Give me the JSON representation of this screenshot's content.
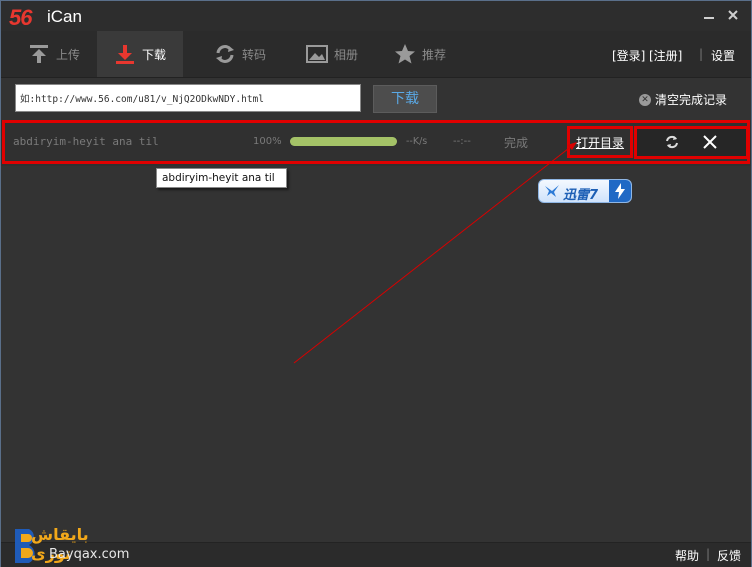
{
  "app": {
    "logo": "56",
    "name": "iCan"
  },
  "tabs": [
    {
      "label": "上传",
      "icon": "upload-icon"
    },
    {
      "label": "下载",
      "icon": "download-icon"
    },
    {
      "label": "转码",
      "icon": "convert-icon"
    },
    {
      "label": "相册",
      "icon": "album-icon"
    },
    {
      "label": "推荐",
      "icon": "star-icon"
    }
  ],
  "account": {
    "login": "[登录]",
    "register": "[注册]",
    "separator": "|",
    "settings": "设置"
  },
  "url_bar": {
    "value": "如:http://www.56.com/u81/v_NjQ2ODkwNDY.html",
    "download_button": "下载",
    "clear_label": "清空完成记录"
  },
  "task": {
    "filename": "abdiryim-heyit ana til",
    "percent": "100%",
    "progress": 1.0,
    "speed": "--K/s",
    "eta": "--:--",
    "status": "完成",
    "open_dir": "打开目录"
  },
  "tooltip": "abdiryim-heyit ana til",
  "xunlei": {
    "label": "迅雷7"
  },
  "footer": {
    "help": "帮助",
    "separator": "|",
    "feedback": "反馈"
  },
  "watermark": {
    "arabic": "بايقاش تورى",
    "site": "Bayqax.com"
  },
  "colors": {
    "accent_red": "#e8372f",
    "highlight_red": "#e00000",
    "progress_green": "#a4c267",
    "link_blue": "#5aa9e6"
  }
}
